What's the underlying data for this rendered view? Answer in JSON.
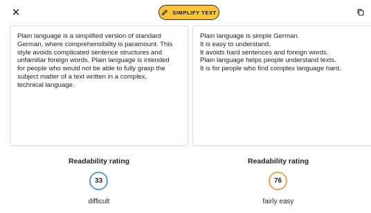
{
  "toolbar": {
    "close_label": "✕",
    "simplify_label": "SIMPLIFY TEXT",
    "accent_color": "#f6c53b"
  },
  "original": {
    "text": "Plain language is a simplified version of standard\nGerman, where comprehensibility is paramount. This\nstyle avoids complicated sentence structures and\nunfamiliar foreign words. Plain language is intended\nfor people who would not be able to fully grasp the\nsubject matter of a text written in a complex,\ntechnical language."
  },
  "simplified": {
    "text": "Plain language is simple German.\nIt is easy to understand.\nIt avoids hard sentences and foreign words.\nPlain language helps people understand texts.\nIt is for people who find complex language hard."
  },
  "readability_left": {
    "title": "Readability rating",
    "score": "33",
    "label": "difficult",
    "color": "#5b9bd5"
  },
  "readability_right": {
    "title": "Readability rating",
    "score": "76",
    "label": "fairly easy",
    "color": "#f0a050"
  },
  "icons": {
    "close": "close-icon",
    "pencil": "pencil-icon",
    "copy": "copy-icon"
  }
}
